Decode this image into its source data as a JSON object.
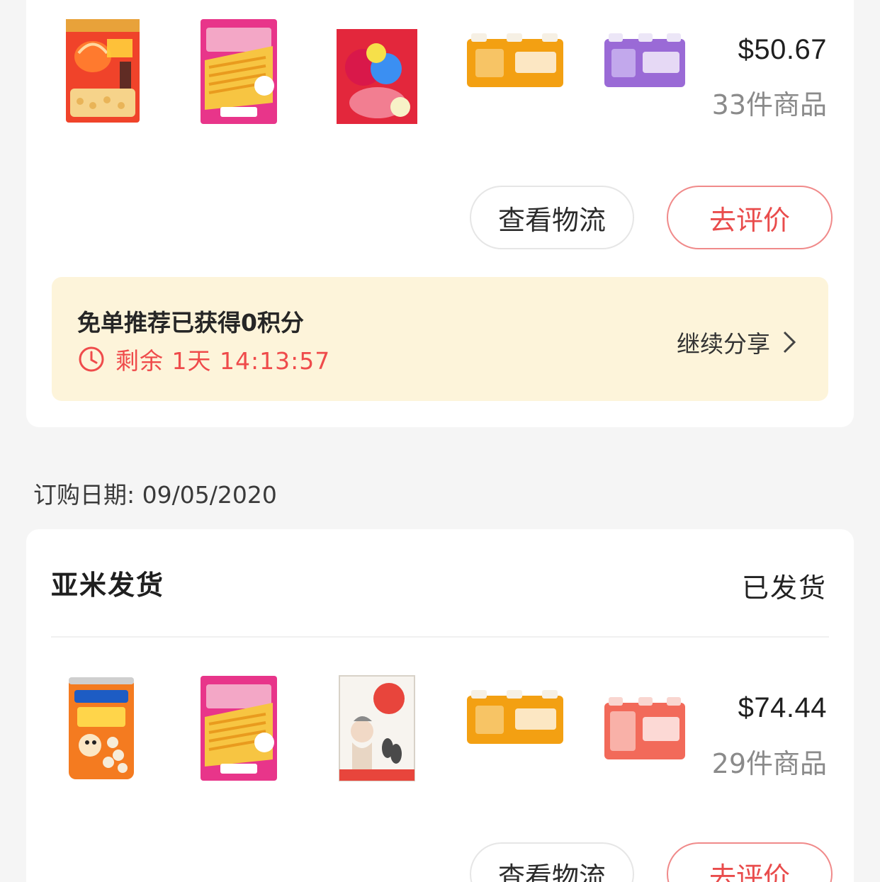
{
  "orders": [
    {
      "price": "$50.67",
      "item_count": "33件商品",
      "products": [
        {
          "name": "shrimp-crackers-icon",
          "color": "#f0432a"
        },
        {
          "name": "shrimp-chips-icon",
          "color": "#e8358a"
        },
        {
          "name": "q-candy-icon",
          "color": "#e3273c"
        },
        {
          "name": "orange-drink-pack-icon",
          "color": "#f3a012"
        },
        {
          "name": "purple-drink-pack-icon",
          "color": "#9a6ad6"
        }
      ],
      "buttons": {
        "logistics": "查看物流",
        "review": "去评价"
      },
      "banner": {
        "title": "免单推荐已获得0积分",
        "timer": "剩余 1天 14:13:57",
        "share": "继续分享"
      }
    },
    {
      "order_date": "订购日期: 09/05/2020",
      "shipper": "亚米发货",
      "status": "已发货",
      "price": "$74.44",
      "item_count": "29件商品",
      "products": [
        {
          "name": "wangzai-can-icon",
          "color": "#f47b20"
        },
        {
          "name": "shrimp-chips-icon",
          "color": "#e8358a"
        },
        {
          "name": "sunflower-seeds-box-icon",
          "color": "#e8453c"
        },
        {
          "name": "orange-drink-pack-icon",
          "color": "#f3a012"
        },
        {
          "name": "pink-drink-pack-icon",
          "color": "#f26a5a"
        }
      ],
      "buttons": {
        "logistics": "查看物流",
        "review": "去评价"
      }
    }
  ],
  "colors": {
    "accent": "#e94c4c",
    "banner_bg": "#fdf4da",
    "page_bg": "#f5f5f5"
  }
}
